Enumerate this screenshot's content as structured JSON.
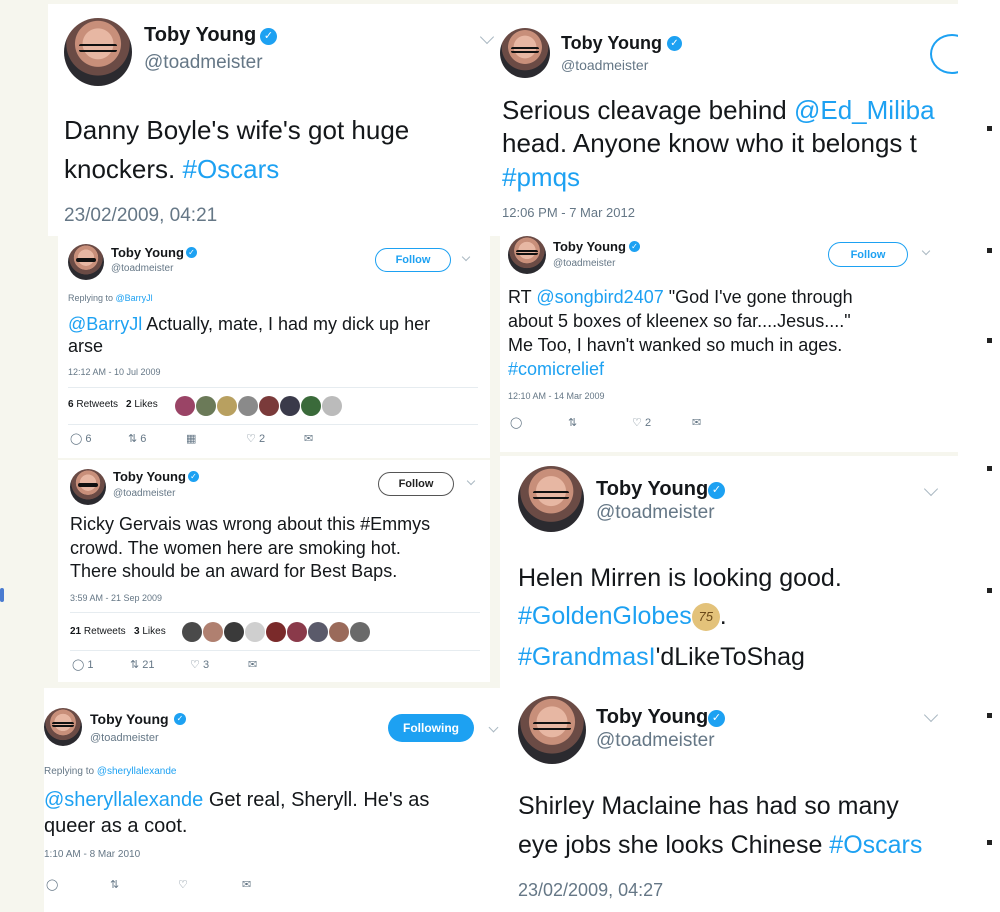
{
  "tweets": {
    "t1": {
      "name": "Toby Young",
      "handle": "@toadmeister",
      "text_a": "Danny Boyle's wife's got huge",
      "text_b": "knockers. ",
      "hashtag": "#Oscars",
      "timestamp": "23/02/2009, 04:21"
    },
    "t2": {
      "name": "Toby Young",
      "handle": "@toadmeister",
      "text_a": "Serious cleavage behind ",
      "mention": "@Ed_Miliba",
      "text_b": "head. Anyone know who it belongs t",
      "hashtag": "#pmqs",
      "timestamp": "12:06 PM - 7 Mar 2012"
    },
    "t3": {
      "name": "Toby Young",
      "handle": "@toadmeister",
      "follow_label": "Follow",
      "replying_prefix": "Replying to ",
      "replying_to": "@BarryJl",
      "mention": "@BarryJl",
      "text_a": " Actually, mate, I had my dick up her",
      "text_b": "arse",
      "timestamp": "12:12 AM - 10 Jul 2009",
      "retweets": "6",
      "retweets_label": "Retweets",
      "likes": "2",
      "likes_label": "Likes",
      "replies_count": "6",
      "retweet_count": "6",
      "like_count": "2"
    },
    "t4": {
      "name": "Toby Young",
      "handle": "@toadmeister",
      "follow_label": "Follow",
      "retweet_prefix": "RT ",
      "mention": "@songbird2407",
      "text_a": " \"God I've gone through",
      "text_b": "about 5 boxes of kleenex so far....Jesus....\"",
      "text_c": "Me Too, I havn't wanked so much in ages.",
      "hashtag": "#comicrelief",
      "timestamp": "12:10 AM - 14 Mar 2009",
      "like_count": "2"
    },
    "t5": {
      "name": "Toby Young",
      "handle": "@toadmeister",
      "follow_label": "Follow",
      "text_a": "Ricky Gervais was wrong about this #Emmys",
      "text_b": "crowd. The women here are smoking hot.",
      "text_c": "There should be an award for Best Baps.",
      "timestamp": "3:59 AM - 21 Sep 2009",
      "retweets": "21",
      "retweets_label": "Retweets",
      "likes": "3",
      "likes_label": "Likes",
      "replies_count": "1",
      "retweet_count": "21",
      "like_count": "3"
    },
    "t6": {
      "name": "Toby Young",
      "handle": "@toadmeister",
      "text_a": "Helen Mirren is looking good.",
      "hashtag1": "#GoldenGlobes",
      "badge": "75",
      "after_badge": ".",
      "hashtag2": "#GrandmasI",
      "text_b": "'dLikeToShag"
    },
    "t7": {
      "name": "Toby Young",
      "handle": "@toadmeister",
      "following_label": "Following",
      "replying_prefix": "Replying to ",
      "replying_to": "@sheryllalexande",
      "mention": "@sheryllalexande",
      "text_a": " Get real, Sheryll. He's as",
      "text_b": "queer as a coot.",
      "timestamp": "1:10 AM - 8 Mar 2010"
    },
    "t8": {
      "name": "Toby Young",
      "handle": "@toadmeister",
      "text_a": "Shirley Maclaine has had so many",
      "text_b": "eye jobs she looks Chinese ",
      "hashtag": "#Oscars",
      "timestamp": "23/02/2009, 04:27"
    }
  },
  "colors": {
    "link": "#1da1f2",
    "muted": "#657786",
    "text": "#14171a"
  }
}
